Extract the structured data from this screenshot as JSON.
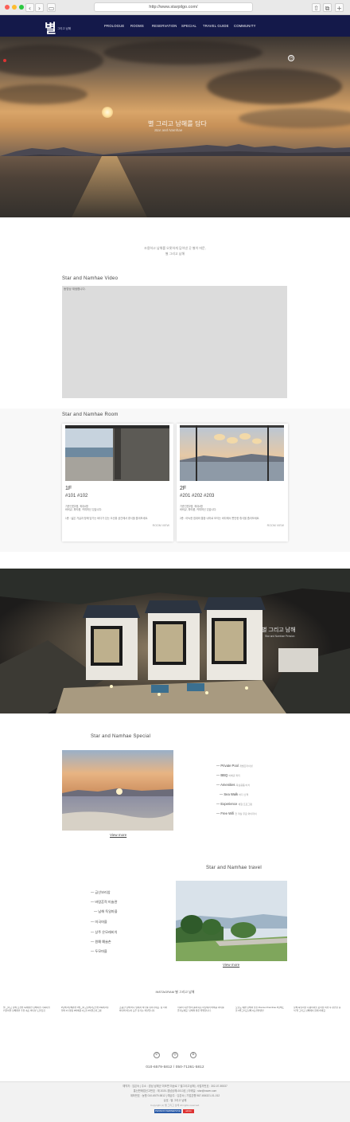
{
  "browser": {
    "url": "http://www.starpilgo.com/"
  },
  "nav": {
    "logo": "별",
    "logo_sub": "그리고 남해",
    "items": [
      "PROLOGUE",
      "ROOMS",
      "RESERVATION",
      "SPECIAL",
      "TRAVEL GUIDE",
      "COMMUNITY"
    ]
  },
  "hero": {
    "title": "별 그리고 남해를 담다",
    "subtitle": "Star and Namhae"
  },
  "intro": {
    "line1": "조용하고 남해를 오롯하게 담아낸 곳 별이 머문,",
    "line2": "별 그리고 남해"
  },
  "video": {
    "title": "Star and Namhae Video",
    "label": "동영상 재생합니다."
  },
  "rooms": {
    "title": "Star and Namhae Room",
    "cards": [
      {
        "floor": "1F",
        "rooms": "#101  #102",
        "info1": "기준인원2명, 최대4명",
        "info2": "바비큐, 파티룸, 커피머신 있습니다.",
        "desc": "1층 : 넓은 거실과 창에 담기는 바다가 있는 오션뷰 공간에서 휴식을 즐겨보세요.",
        "link": "ROOM VIEW"
      },
      {
        "floor": "2F",
        "rooms": "#201  #202  #203",
        "info1": "기준인원2명, 최대4명",
        "info2": "바비큐, 파티룸, 커피머신 있습니다.",
        "desc": "2층 : 아늑한 침대와 통창 너머로 보이는 바다에서 편안한 휴식을 즐겨보세요.",
        "link": "ROOM VIEW"
      }
    ]
  },
  "aerial": {
    "title": "별 그리고 남해",
    "subtitle": "Star and Namhae Pension"
  },
  "special": {
    "title": "Star and Namhae Special",
    "view_more": "View more",
    "features": [
      {
        "label": "Private Pool",
        "note": "개별프라이빗"
      },
      {
        "label": "BBQ",
        "note": "바베큐 파티"
      },
      {
        "label": "Amenities",
        "note": "욕실용품 비치"
      },
      {
        "label": "Sea Walk",
        "note": "바다 산책"
      },
      {
        "label": "Experience",
        "note": "체험 프로그램"
      },
      {
        "label": "Free Wifi",
        "note": "전 객실 무료 와이파이"
      }
    ]
  },
  "travel": {
    "title": "Star and Namhae travel",
    "view_more": "View more",
    "items": [
      "금산보리암",
      "바람흔적 미술관",
      "남해 독일마을",
      "미국마을",
      "상주 은모래비치",
      "원예 예술촌",
      "두모마을"
    ]
  },
  "instagram": {
    "title": "INSTAGRAM 별 그리고 남해",
    "posts": [
      "별 그리고 남해 오션뷰 독채펜션 남해여행 가족여행 커플여행 남해펜션 추천 숙소 바다뷰 노을맛집",
      "#남해 #남해펜션 #별그리고남해 #오션뷰 #독채 #풀빌라 #수영장 #바베큐 #노을 #여행스타그램",
      "조용한 남해 바다 앞에서 하루를 쉬어가세요. 창 너머 바다와 하늘이 모두 담기는 객실입니다.",
      "저녁이 되면 별이 쏟아지는 마당에서 바베큐 파티를 즐겨보세요. 남해의 밤은 특별합니다.",
      "오늘도 예쁜 남해의 일몰 #sunset #namhae #남해노을 #별그리고남해 #오션뷰펜션",
      "남해 독일마을 다랭이마을 보리암 여행 후 편안한 휴식 별 그리고 남해에서 함께 하세요"
    ]
  },
  "contact": {
    "phone": "010-6579-5812 / 050-71361-5812"
  },
  "footer": {
    "line1": "예약자 : 임은숙  |  주소 : 경남 남해군 미조면 미송로 7 별그리고남해  |  사업자번호 : 302-07-89337",
    "line2": "통신판매업신고번호 : 제 2020-경남남해-0013호  |  이메일 : star@naver.com",
    "line3": "계좌번호 : 농협 010-6579-5812  |  예금주 : 임은숙  |  기업은행 987-654321-01-012",
    "line4": "상호 : 별 그리고 남해",
    "copyright": "Copyright (c) 별 그리고 남해 All rights reserved.",
    "badge1": "PENSION WEBSERVICE",
    "badge2": "admin"
  }
}
